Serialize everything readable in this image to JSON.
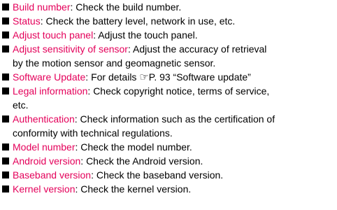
{
  "items": [
    {
      "term": "Build number",
      "sep": ": ",
      "lines": [
        "Check the build number."
      ]
    },
    {
      "term": "Status",
      "sep": ": ",
      "lines": [
        "Check the battery level, network in use, etc."
      ]
    },
    {
      "term": "Adjust touch panel",
      "sep": ": ",
      "lines": [
        "Adjust the touch panel."
      ]
    },
    {
      "term": "Adjust sensitivity of sensor",
      "sep": ": ",
      "lines": [
        "Adjust the accuracy of retrieval",
        "by the motion sensor and geomagnetic sensor."
      ]
    },
    {
      "term": "Software Update",
      "sep": ": ",
      "text_before_ref": "For details ",
      "ref_icon": "☞",
      "text_after_ref": "P. 93 “Software update”"
    },
    {
      "term": "Legal information",
      "sep": ": ",
      "lines": [
        "Check copyright notice, terms of service,",
        "etc."
      ]
    },
    {
      "term": "Authentication",
      "sep": ": ",
      "lines": [
        "Check information such as the certification of",
        "conformity with technical regulations."
      ]
    },
    {
      "term": "Model number",
      "sep": ": ",
      "lines": [
        "Check the model number."
      ]
    },
    {
      "term": "Android version",
      "sep": ": ",
      "lines": [
        "Check the Android version."
      ]
    },
    {
      "term": "Baseband version",
      "sep": ": ",
      "lines": [
        "Check the baseband version."
      ]
    },
    {
      "term": "Kernel version",
      "sep": ": ",
      "lines": [
        "Check the kernel version."
      ]
    }
  ],
  "colors": {
    "term": "#e4005a",
    "text": "#000000",
    "bullet": "#000000"
  }
}
